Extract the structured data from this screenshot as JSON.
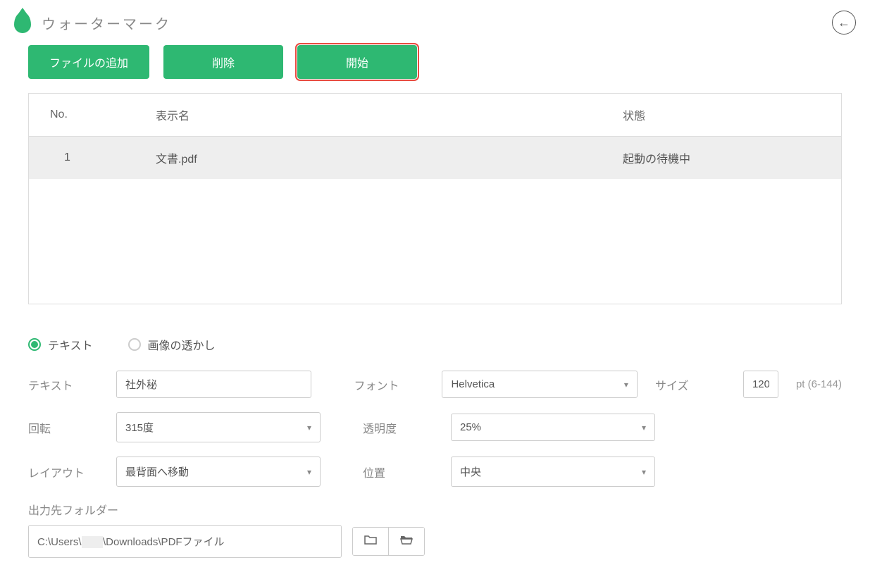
{
  "header": {
    "title": "ウォーターマーク"
  },
  "toolbar": {
    "add_file": "ファイルの追加",
    "delete": "削除",
    "start": "開始"
  },
  "table": {
    "headers": {
      "no": "No.",
      "name": "表示名",
      "status": "状態"
    },
    "rows": [
      {
        "no": "1",
        "name": "文書.pdf",
        "status": "起動の待機中"
      }
    ]
  },
  "watermark_type": {
    "text": "テキスト",
    "image": "画像の透かし"
  },
  "form": {
    "text_label": "テキスト",
    "text_value": "社外秘",
    "font_label": "フォント",
    "font_value": "Helvetica",
    "size_label": "サイズ",
    "size_value": "120",
    "size_hint": "pt (6-144)",
    "rotation_label": "回転",
    "rotation_value": "315度",
    "opacity_label": "透明度",
    "opacity_value": "25%",
    "layout_label": "レイアウト",
    "layout_value": "最背面へ移動",
    "position_label": "位置",
    "position_value": "中央"
  },
  "output": {
    "label": "出力先フォルダー",
    "path_prefix": "C:\\Users\\",
    "path_redacted": "xxx",
    "path_suffix": "\\Downloads\\PDFファイル"
  }
}
